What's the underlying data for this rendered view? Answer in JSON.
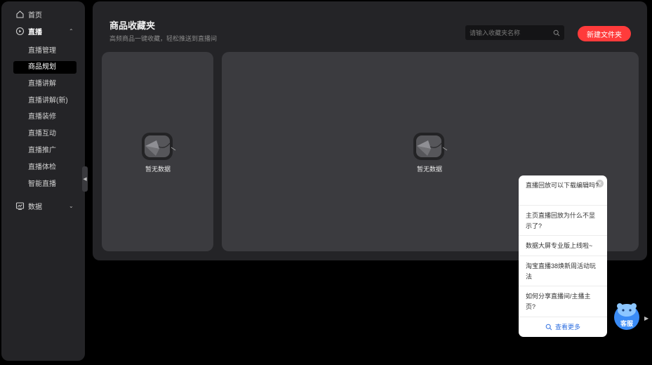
{
  "sidebar": {
    "home_label": "首页",
    "live_label": "直播",
    "live_items": [
      {
        "label": "直播管理"
      },
      {
        "label": "商品规划"
      },
      {
        "label": "直播讲解"
      },
      {
        "label": "直播讲解(新)"
      },
      {
        "label": "直播装修"
      },
      {
        "label": "直播互动"
      },
      {
        "label": "直播推广"
      },
      {
        "label": "直播体检"
      },
      {
        "label": "智能直播"
      }
    ],
    "active_item": "商品规划",
    "data_label": "数据"
  },
  "header": {
    "title": "商品收藏夹",
    "subtitle": "高频商品一键收藏，轻松推送到直播间",
    "search_placeholder": "请输入收藏夹名称",
    "new_folder_label": "新建文件夹"
  },
  "panels": {
    "left_empty_text": "暂无数据",
    "right_empty_text": "暂无数据"
  },
  "faq": {
    "items": [
      {
        "text": "直播回放可以下载编辑吗?"
      },
      {
        "text": "主页直播回放为什么不显示了?"
      },
      {
        "text": "数据大屏专业版上线啦~"
      },
      {
        "text": "淘宝直播38焕新周活动玩法"
      },
      {
        "text": "如何分享直播间/主播主页?"
      }
    ],
    "more_label": "查看更多"
  },
  "customer_service": {
    "label": "客服"
  },
  "colors": {
    "accent": "#ff3b3b",
    "link": "#2f6fe0",
    "panel": "#3b3b3f",
    "card": "#242427"
  }
}
